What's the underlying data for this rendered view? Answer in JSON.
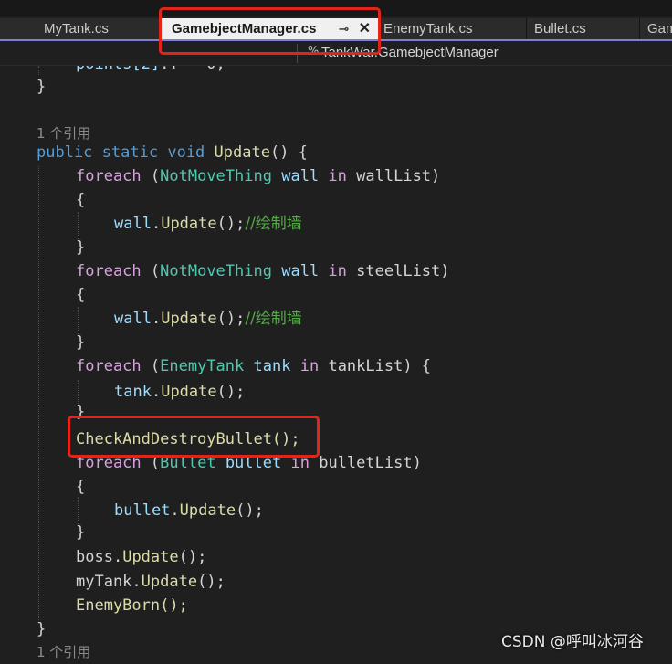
{
  "tabs": [
    {
      "label": "MyTank.cs"
    },
    {
      "label": "GamebjectManager.cs",
      "pin": "⊸",
      "close": "✕"
    },
    {
      "label": "EnemyTank.cs"
    },
    {
      "label": "Bullet.cs"
    },
    {
      "label": "Gam"
    }
  ],
  "nav": {
    "icon": "%",
    "text": "TankWar.GamebjectManager"
  },
  "code": {
    "l_top": {
      "t1": "points[2]",
      "t2": ".Y = 0;"
    },
    "l1": {
      "brace": "}"
    },
    "l2": {
      "ref": "1 个引用"
    },
    "l3": {
      "k1": "public",
      "k2": "static",
      "k3": "void",
      "fn": "Update",
      "rest": "() {"
    },
    "l4": {
      "kw": "foreach",
      "p1": " (",
      "ty": "NotMoveThing",
      "v": "wall",
      "in": "in",
      "rest": "wallList)"
    },
    "l5": {
      "brace": "{"
    },
    "l6": {
      "v": "wall",
      "dot": ".",
      "fn": "Update",
      "rest": "();",
      "cm": "//绘制墙"
    },
    "l7": {
      "brace": "}"
    },
    "l8": {
      "kw": "foreach",
      "p1": " (",
      "ty": "NotMoveThing",
      "v": "wall",
      "in": "in",
      "rest": "steelList)"
    },
    "l9": {
      "brace": "{"
    },
    "l10": {
      "v": "wall",
      "dot": ".",
      "fn": "Update",
      "rest": "();",
      "cm": "//绘制墙"
    },
    "l11": {
      "brace": "}"
    },
    "l12": {
      "kw": "foreach",
      "p1": " (",
      "ty": "EnemyTank",
      "v": "tank",
      "in": "in",
      "rest": "tankList) {"
    },
    "l13": {
      "v": "tank",
      "dot": ".",
      "fn": "Update",
      "rest": "();"
    },
    "l14": {
      "brace": "}"
    },
    "l15": {
      "text": "CheckAndDestroyBullet();"
    },
    "l16": {
      "kw": "foreach",
      "p1": " (",
      "ty": "Bullet",
      "v": "bullet",
      "in": "in",
      "rest": "bulletList)"
    },
    "l17": {
      "brace": "{"
    },
    "l18": {
      "v": "bullet",
      "dot": ".",
      "fn": "Update",
      "rest": "();"
    },
    "l19": {
      "brace": "}"
    },
    "l20": {
      "obj": "boss",
      "dot": ".",
      "fn": "Update",
      "rest": "();"
    },
    "l21": {
      "obj": "myTank",
      "dot": ".",
      "fn": "Update",
      "rest": "();"
    },
    "l22": {
      "text": "EnemyBorn();"
    },
    "l23": {
      "brace": "}"
    },
    "l24": {
      "ref": "1 个引用"
    }
  },
  "watermark": "CSDN @呼叫冰河谷",
  "colors": {
    "highlight_box": "#e1251b",
    "keyword": "#569cd6",
    "type": "#4ec9b0",
    "comment": "#57a64a"
  }
}
